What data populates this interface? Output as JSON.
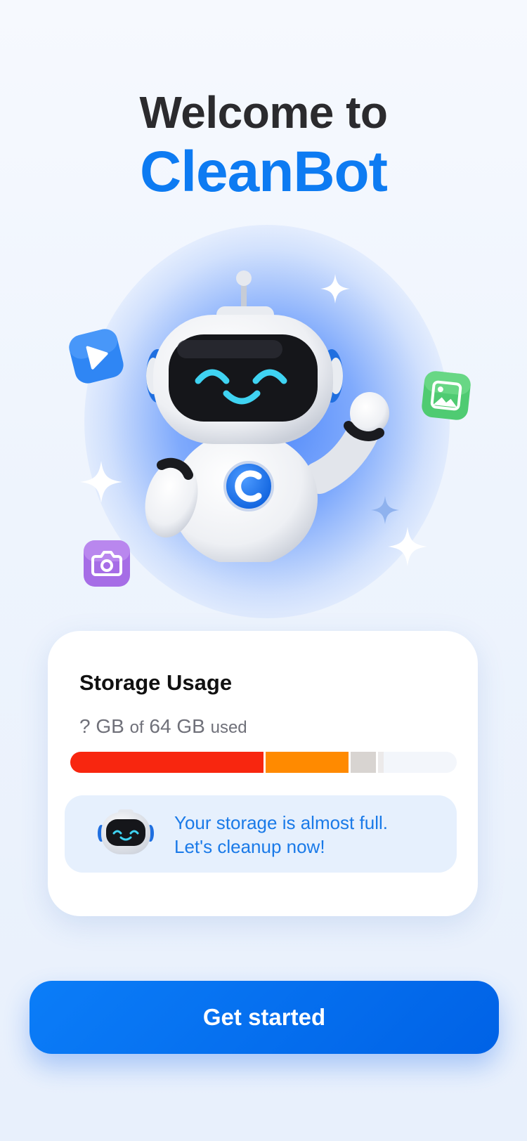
{
  "header": {
    "welcome": "Welcome to",
    "app_name": "CleanBot"
  },
  "icons": [
    "robot-mascot",
    "video-play-icon",
    "image-icon",
    "camera-icon",
    "sparkle-icon"
  ],
  "storage": {
    "title": "Storage Usage",
    "used_value": "?",
    "used_unit": "GB",
    "of_text": "of",
    "total_value": "64",
    "total_unit": "GB",
    "used_text": "used",
    "segments": [
      {
        "fraction": 0.5,
        "color": "#f8260f"
      },
      {
        "fraction": 0.22,
        "color": "#ff8a00"
      },
      {
        "fraction": 0.07,
        "color": "#d8d4d1"
      },
      {
        "fraction": 0.02,
        "color": "#eceaea"
      }
    ],
    "message_line1": "Your storage is almost full.",
    "message_line2": "Let's cleanup now!"
  },
  "cta": {
    "label": "Get started"
  },
  "colors": {
    "brand": "#0d7bf2",
    "title": "#2b2b2e",
    "cta": "#0b7df8"
  }
}
